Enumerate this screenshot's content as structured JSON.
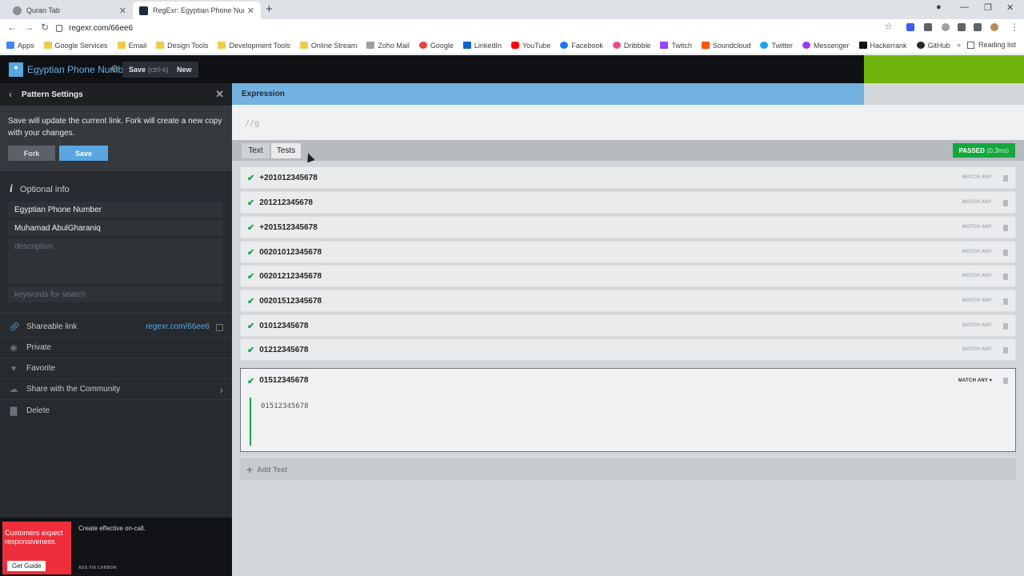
{
  "browser": {
    "tabs": [
      {
        "label": "Quran Tab"
      },
      {
        "label": "RegExr: Egyptian Phone Number"
      }
    ],
    "url": "regexr.com/66ee6",
    "bookmarks": [
      {
        "label": "Apps"
      },
      {
        "label": "Google Services"
      },
      {
        "label": "Email"
      },
      {
        "label": "Design Tools"
      },
      {
        "label": "Development Tools"
      },
      {
        "label": "Online Stream"
      },
      {
        "label": "Zoho Mail"
      },
      {
        "label": "Google"
      },
      {
        "label": "LinkedIn"
      },
      {
        "label": "YouTube"
      },
      {
        "label": "Facebook"
      },
      {
        "label": "Dribbble"
      },
      {
        "label": "Twitch"
      },
      {
        "label": "Soundcloud"
      },
      {
        "label": "Twitter"
      },
      {
        "label": "Messenger"
      },
      {
        "label": "Hackerrank"
      },
      {
        "label": "GitHub"
      }
    ],
    "reading_list": "Reading list"
  },
  "header": {
    "title": "Egyptian Phone Number",
    "save_label": "Save",
    "save_shortcut": "(ctrl-s)",
    "new_label": "New"
  },
  "sidebar": {
    "title": "Pattern Settings",
    "notice": "Save will update the current link. Fork will create a new copy with your changes.",
    "fork_label": "Fork",
    "save_label": "Save",
    "optional_info": "Optional info",
    "name_value": "Egyptian Phone Number",
    "author_value": "Muhamad AbulGharaniq",
    "description_placeholder": "description",
    "keywords_placeholder": "keywords for search",
    "shareable_label": "Shareable link",
    "shareable_url": "regexr.com/66ee6",
    "private_label": "Private",
    "favorite_label": "Favorite",
    "share_label": "Share with the Community",
    "delete_label": "Delete"
  },
  "ad": {
    "headline": "Customers expect responsiveness.",
    "button": "Get Guide",
    "text": "Create effective on-call.",
    "via": "ADS VIA CARBON"
  },
  "main": {
    "expression_title": "Expression",
    "expression_text": "//g",
    "tab_text": "Text",
    "tab_tests": "Tests",
    "passed_label": "PASSED",
    "passed_time": "(0.3ms)",
    "match_any": "MATCH ANY",
    "match_any_active": "MATCH ANY ▾",
    "tests": [
      "+201012345678",
      "201212345678",
      "+201512345678",
      "00201012345678",
      "00201212345678",
      "00201512345678",
      "01012345678",
      "01212345678",
      "01512345678"
    ],
    "active_test_content": "01512345678",
    "add_test": "Add Test"
  },
  "colors": {
    "accent": "#5aa6e0",
    "pass": "#13a73e",
    "banner": "#6fb50d"
  }
}
